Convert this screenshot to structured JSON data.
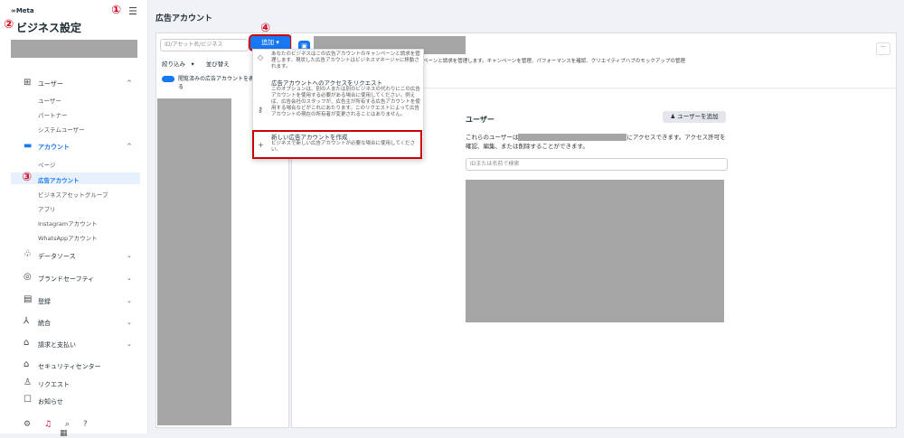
{
  "sidebar": {
    "meta_logo": "∞Meta",
    "title": "ビジネス設定",
    "marker1": "①",
    "marker2": "②",
    "marker3": "③",
    "sections": [
      {
        "icon": "users-icon",
        "label": "ユーザー",
        "chevron": "^"
      },
      {
        "icon": "accounts-icon",
        "label": "アカウント",
        "chevron": "^"
      },
      {
        "icon": "datasource-icon",
        "label": "データソース",
        "chevron": "⌄"
      },
      {
        "icon": "shield-icon",
        "label": "ブランドセーフティ",
        "chevron": "⌄"
      },
      {
        "icon": "register-icon",
        "label": "登録",
        "chevron": "⌄"
      },
      {
        "icon": "integration-icon",
        "label": "統合",
        "chevron": "⌄"
      },
      {
        "icon": "bank-icon",
        "label": "請求と支払い",
        "chevron": "⌄"
      },
      {
        "icon": "lock-icon",
        "label": "セキュリティセンター"
      },
      {
        "icon": "request-icon",
        "label": "リクエスト"
      },
      {
        "icon": "notify-icon",
        "label": "お知らせ"
      }
    ],
    "users_sub": [
      "ユーザー",
      "パートナー",
      "システムユーザー"
    ],
    "accounts_sub": [
      "ページ",
      "広告アカウント",
      "ビジネスアセットグループ",
      "アプリ",
      "Instagramアカウント",
      "WhatsAppアカウント"
    ]
  },
  "main": {
    "page_title": "広告アカウント",
    "search_placeholder": "ID/アセット名/ビジネス",
    "filter_label": "絞り込み",
    "sort_label": "並び替え",
    "toggle_label": "閲覧済みの広告アカウントを表示する",
    "add_button": "追加 ▾",
    "marker4": "④",
    "account_desc": "あなたのビジネスはこの広告アカウントのキャンペーンと請求を管理します。キャンペーンを管理、パフォーマンスを確認、クリエイティブハブのモックアップの管理",
    "more": "···"
  },
  "dropdown": {
    "item1_desc": "あなたのビジネスはこの広告アカウントのキャンペーンと請求を管理します。現状した広告アカウントはビジネスマネージャに移動されます。",
    "item2_title": "広告アカウントへのアクセスをリクエスト",
    "item2_desc": "このオプションは、別の人または別のビジネスの代わりにこの広告アカウントを使用する必要がある場合に使用してください。例えば、広告会社のスタッフが、広告主が所有する広告アカウントを使用する場合などがこれにあたります。このリクエストによって広告アカウントの現在の所有者が変更されることはありません。",
    "item3_title": "新しい広告アカウントを作成",
    "item3_desc": "ビジネスで新しい広告アカウントが必要な場合に使用してください。"
  },
  "users_card": {
    "title": "ユーザー",
    "add_user": "ユーザーを追加",
    "text_before": "これらのユーザーは",
    "text_after": "にアクセスできます。アクセス許可を確認、編集、または削除することができます。",
    "search_placeholder": "IDまたは名前で検索"
  }
}
